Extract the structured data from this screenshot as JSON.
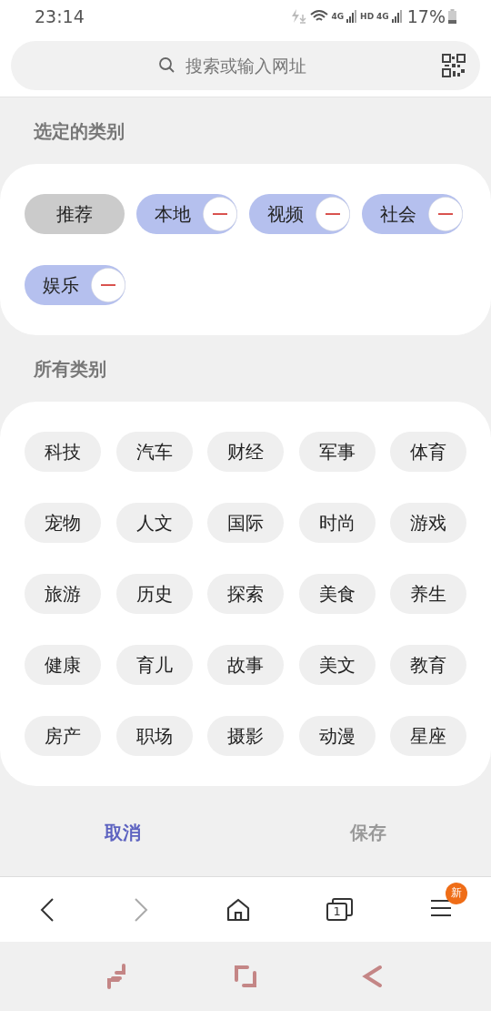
{
  "status_bar": {
    "time": "23:14",
    "network_labels": [
      "4G",
      "HD",
      "4G"
    ],
    "battery": "17%"
  },
  "search": {
    "placeholder": "搜索或输入网址"
  },
  "selected_section": {
    "title": "选定的类别",
    "items": [
      {
        "label": "推荐",
        "kind": "fixed"
      },
      {
        "label": "本地",
        "kind": "removable"
      },
      {
        "label": "视频",
        "kind": "removable"
      },
      {
        "label": "社会",
        "kind": "removable"
      },
      {
        "label": "娱乐",
        "kind": "removable"
      }
    ]
  },
  "all_section": {
    "title": "所有类别",
    "items": [
      "科技",
      "汽车",
      "财经",
      "军事",
      "体育",
      "宠物",
      "人文",
      "国际",
      "时尚",
      "游戏",
      "旅游",
      "历史",
      "探索",
      "美食",
      "养生",
      "健康",
      "育儿",
      "故事",
      "美文",
      "教育",
      "房产",
      "职场",
      "摄影",
      "动漫",
      "星座"
    ]
  },
  "actions": [
    {
      "label": "取消",
      "disabled": false
    },
    {
      "label": "保存",
      "disabled": true
    }
  ],
  "toolbar": {
    "forward_disabled": true,
    "tab_count": "1",
    "menu_badge": "新"
  }
}
